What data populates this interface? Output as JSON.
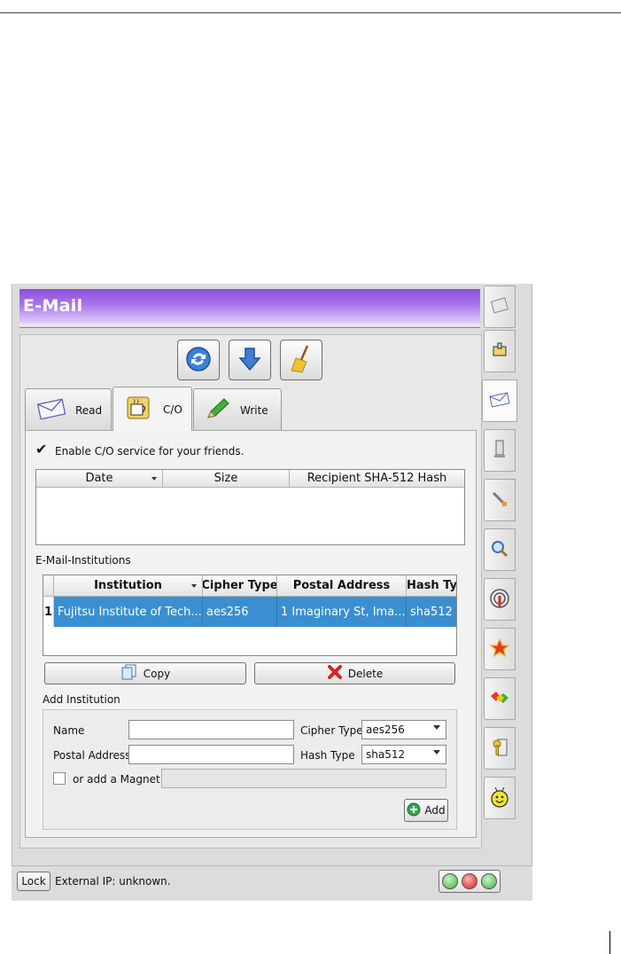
{
  "header": {
    "title": "E-Mail"
  },
  "tabs": [
    {
      "label": "Read",
      "icon": "envelope-icon"
    },
    {
      "label": "C/O",
      "icon": "coffee-icon",
      "active": true
    },
    {
      "label": "Write",
      "icon": "pencil-icon"
    }
  ],
  "co": {
    "enable_label": "Enable C/O service for your friends.",
    "enabled": true,
    "columns": [
      "Date",
      "Size",
      "Recipient SHA-512 Hash"
    ]
  },
  "institutions": {
    "section_label": "E-Mail-Institutions",
    "columns": [
      "Institution",
      "Cipher Type",
      "Postal Address",
      "Hash Typ"
    ],
    "rows": [
      {
        "index": "1",
        "institution": "Fujitsu Institute of Tech...",
        "cipher": "aes256",
        "postal": "1 Imaginary St, Ima...",
        "hash": "sha512"
      }
    ],
    "copy_label": "Copy",
    "delete_label": "Delete"
  },
  "add_institution": {
    "group_label": "Add Institution",
    "name_label": "Name",
    "postal_label": "Postal Address",
    "cipher_label": "Cipher Type",
    "cipher_value": "aes256",
    "hash_label": "Hash Type",
    "hash_value": "sha512",
    "magnet_label": "or add a Magnet",
    "add_label": "Add"
  },
  "status": {
    "lock_label": "Lock",
    "ip_text": "External IP: unknown."
  },
  "colors": {
    "accent": "#a873ec",
    "selection": "#3a8fd0"
  }
}
